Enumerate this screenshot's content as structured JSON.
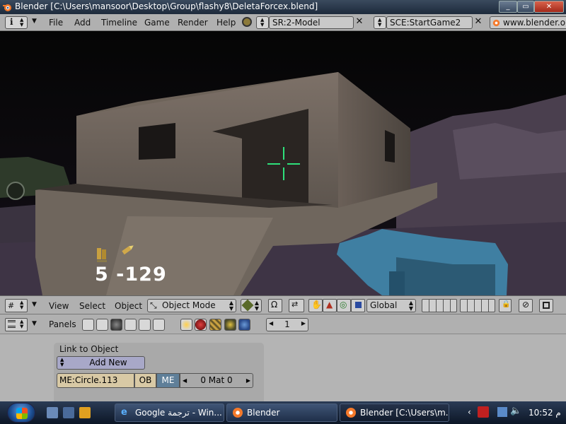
{
  "window": {
    "title": "Blender [C:\\Users\\mansoor\\Desktop\\Group\\flashy8\\DeletaForcex.blend]",
    "buttons": [
      "_",
      "▭",
      "✕"
    ]
  },
  "menubar": {
    "items": [
      "File",
      "Add",
      "Timeline",
      "Game",
      "Render",
      "Help"
    ],
    "screen": "SR:2-Model",
    "scene": "SCE:StartGame2",
    "url": "www.blender.org"
  },
  "viewport": {
    "hud_ammo": "5 -129"
  },
  "view3d_header": {
    "menus": [
      "View",
      "Select",
      "Object"
    ],
    "mode": "Object Mode",
    "orientation": "Global"
  },
  "buttons_header": {
    "panels_label": "Panels",
    "frame": "1"
  },
  "link_panel": {
    "title": "Link to Object",
    "add_new": "Add New",
    "mesh_name": "ME:Circle.113",
    "ob_label": "OB",
    "me_label": "ME",
    "mat_label": "0 Mat 0"
  },
  "taskbar": {
    "tasks": [
      "Google ترجمة - Win...",
      "Blender",
      "Blender [C:\\Users\\m..."
    ],
    "clock": "10:52 م"
  },
  "colors": {
    "blender_gray": "#b0b0b0",
    "me_button": "#5f7f99",
    "crosshair": "#2ee07a"
  }
}
